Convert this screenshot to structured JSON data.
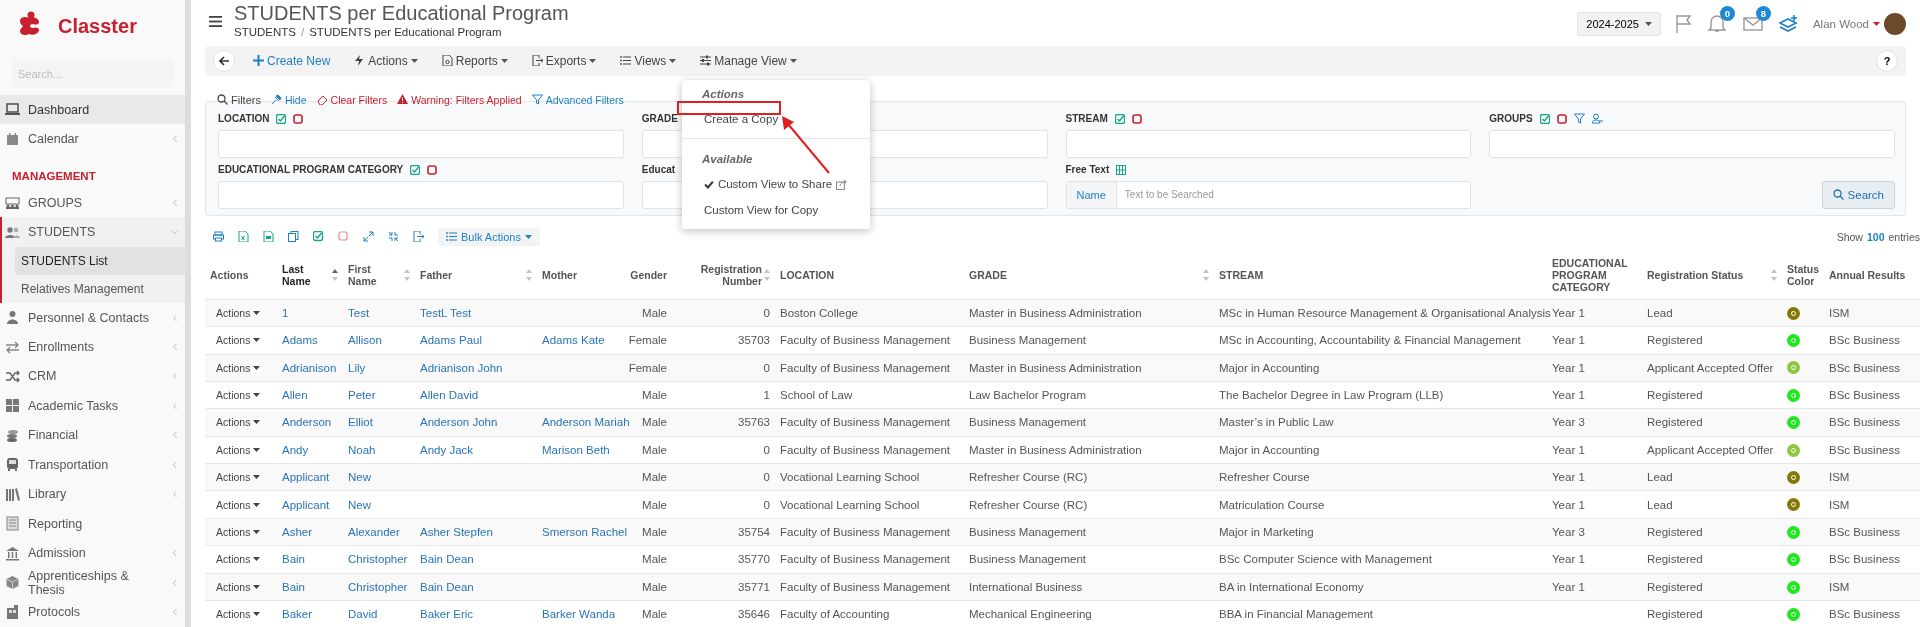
{
  "sidebar": {
    "brand": "Classter",
    "search_placeholder": "Search...",
    "items": [
      {
        "kind": "link",
        "label": "Dashboard",
        "highlighted": true,
        "submenu": false,
        "expanded": false
      },
      {
        "kind": "link",
        "label": "Calendar",
        "highlighted": false,
        "submenu": true,
        "expanded": false
      },
      {
        "kind": "heading",
        "label": "MANAGEMENT"
      },
      {
        "kind": "link",
        "label": "GROUPS",
        "highlighted": false,
        "submenu": true,
        "expanded": false
      },
      {
        "kind": "link",
        "label": "STUDENTS",
        "highlighted": false,
        "submenu": true,
        "expanded": true,
        "children": [
          {
            "label": "STUDENTS List",
            "selected": true
          },
          {
            "label": "Relatives Management",
            "selected": false
          }
        ]
      },
      {
        "kind": "link",
        "label": "Personnel & Contacts",
        "highlighted": false,
        "submenu": true,
        "expanded": false
      },
      {
        "kind": "link",
        "label": "Enrollments",
        "highlighted": false,
        "submenu": true,
        "expanded": false
      },
      {
        "kind": "link",
        "label": "CRM",
        "highlighted": false,
        "submenu": true,
        "expanded": false
      },
      {
        "kind": "link",
        "label": "Academic Tasks",
        "highlighted": false,
        "submenu": true,
        "expanded": false
      },
      {
        "kind": "link",
        "label": "Financial",
        "highlighted": false,
        "submenu": true,
        "expanded": false
      },
      {
        "kind": "link",
        "label": "Transportation",
        "highlighted": false,
        "submenu": true,
        "expanded": false
      },
      {
        "kind": "link",
        "label": "Library",
        "highlighted": false,
        "submenu": true,
        "expanded": false
      },
      {
        "kind": "link",
        "label": "Reporting",
        "highlighted": false,
        "submenu": false,
        "expanded": false
      },
      {
        "kind": "link",
        "label": "Admission",
        "highlighted": false,
        "submenu": true,
        "expanded": false
      },
      {
        "kind": "link",
        "label": "Apprenticeships & Thesis",
        "highlighted": false,
        "submenu": true,
        "expanded": false
      },
      {
        "kind": "link",
        "label": "Protocols",
        "highlighted": false,
        "submenu": true,
        "expanded": false
      }
    ]
  },
  "header": {
    "title": "STUDENTS per Educational Program",
    "breadcrumb": [
      "STUDENTS",
      "STUDENTS per Educational Program"
    ],
    "breadcrumb_separator": "/"
  },
  "topbar": {
    "year": "2024-2025",
    "notifications": "0",
    "messages": "8",
    "user": "Alan Wood"
  },
  "toolbar": {
    "buttons": [
      {
        "label": "Create New",
        "kind": "primary"
      },
      {
        "label": "Actions",
        "kind": "dropdown"
      },
      {
        "label": "Reports",
        "kind": "dropdown"
      },
      {
        "label": "Exports",
        "kind": "dropdown"
      },
      {
        "label": "Views",
        "kind": "dropdown"
      },
      {
        "label": "Manage View",
        "kind": "dropdown"
      }
    ],
    "help": "?"
  },
  "manage_view_menu": {
    "sections": [
      {
        "heading": "Actions",
        "items": [
          {
            "label": "Create a Copy",
            "checked": false,
            "shared": false
          }
        ]
      },
      {
        "heading": "Available",
        "items": [
          {
            "label": "Custom View to Share",
            "checked": true,
            "shared": true
          },
          {
            "label": "Custom View for Copy",
            "checked": false,
            "shared": false
          }
        ]
      }
    ]
  },
  "filters": {
    "title": "Filters",
    "links": [
      {
        "label": "Hide",
        "kind": "info"
      },
      {
        "label": "Clear Filters",
        "kind": "danger"
      },
      {
        "label": "Warning: Filters Applied",
        "kind": "warning"
      },
      {
        "label": "Advanced Filters",
        "kind": "info"
      }
    ],
    "fields": [
      {
        "label": "LOCATION",
        "kind": "select",
        "toggles": true
      },
      {
        "label": "GRADE",
        "kind": "select"
      },
      {
        "label": "STREAM",
        "kind": "select",
        "toggles": true
      },
      {
        "label": "GROUPS",
        "kind": "select_extra",
        "toggles": true
      },
      {
        "label": "EDUCATIONAL PROGRAM CATEGORY",
        "kind": "select",
        "toggles": true
      },
      {
        "label": "Educat",
        "kind": "select"
      },
      {
        "label": "Free Text",
        "kind": "text",
        "toggles": false,
        "addon": "Name",
        "placeholder": "Text to be Searched"
      }
    ],
    "search_button": "Search"
  },
  "table_tools": {
    "bulk_actions": "Bulk Actions",
    "show": "Show",
    "entries_count": "100",
    "entries": "entries"
  },
  "table": {
    "columns": [
      {
        "label": "Actions",
        "kind": "action",
        "sortable": false,
        "sort_active": false
      },
      {
        "label": "Last Name",
        "kind": "link",
        "sortable": true,
        "sort_active": true
      },
      {
        "label": "First Name",
        "kind": "link",
        "sortable": true,
        "sort_active": false
      },
      {
        "label": "Father",
        "kind": "link",
        "sortable": true,
        "sort_active": false
      },
      {
        "label": "Mother",
        "kind": "link",
        "sortable": false,
        "sort_active": false
      },
      {
        "label": "Gender",
        "kind": "right",
        "sortable": false,
        "sort_active": false
      },
      {
        "label": "Registration Number",
        "kind": "right",
        "sortable": true,
        "sort_active": false
      },
      {
        "label": "LOCATION",
        "kind": "text",
        "sortable": false,
        "sort_active": false
      },
      {
        "label": "GRADE",
        "kind": "text",
        "sortable": true,
        "sort_active": false
      },
      {
        "label": "STREAM",
        "kind": "text",
        "sortable": false,
        "sort_active": false
      },
      {
        "label": "EDUCATIONAL PROGRAM CATEGORY",
        "kind": "text",
        "sortable": false,
        "sort_active": false
      },
      {
        "label": "Registration Status",
        "kind": "text",
        "sortable": true,
        "sort_active": false
      },
      {
        "label": "Status Color",
        "kind": "color",
        "sortable": false,
        "sort_active": false
      },
      {
        "label": "Annual Results",
        "kind": "text"
      }
    ],
    "rows": [
      {
        "cells": [
          "Actions",
          "1",
          "Test",
          "TestL Test",
          "",
          "Male",
          "0",
          "Boston College",
          "Master in Business Administration",
          "MSc in Human Resource Management & Organisational Analysis",
          "Year 1",
          "Lead",
          "",
          "ISM"
        ],
        "color": "#827a05"
      },
      {
        "cells": [
          "Actions",
          "Adams",
          "Allison",
          "Adams Paul",
          "Adams Kate",
          "Female",
          "35703",
          "Faculty of Business Management",
          "Business Management",
          "MSc in Accounting, Accountability & Financial Management",
          "Year 1",
          "Registered",
          "",
          "BSc Business"
        ],
        "color": "#1ee81e"
      },
      {
        "cells": [
          "Actions",
          "Adrianison",
          "Lily",
          "Adrianison John",
          "",
          "Female",
          "0",
          "Faculty of Business Management",
          "Master in Business Administration",
          "Major in Accounting",
          "Year 1",
          "Applicant Accepted Offer",
          "",
          "BSc Business"
        ],
        "color": "#8dc63f"
      },
      {
        "cells": [
          "Actions",
          "Allen",
          "Peter",
          "Allen David",
          "",
          "Male",
          "1",
          "School of Law",
          "Law Bachelor Program",
          "The Bachelor Degree in Law Program (LLB)",
          "Year 1",
          "Registered",
          "",
          "BSc Business"
        ],
        "color": "#1ee81e"
      },
      {
        "cells": [
          "Actions",
          "Anderson",
          "Elliot",
          "Anderson John",
          "Anderson Mariah",
          "Male",
          "35763",
          "Faculty of Business Management",
          "Business Management",
          "Master’s in Public Law",
          "Year 3",
          "Registered",
          "",
          "BSc Business"
        ],
        "color": "#1ee81e"
      },
      {
        "cells": [
          "Actions",
          "Andy",
          "Noah",
          "Andy Jack",
          "Marison Beth",
          "Male",
          "0",
          "Faculty of Business Management",
          "Master in Business Administration",
          "Major in Accounting",
          "Year 1",
          "Applicant Accepted Offer",
          "",
          "BSc Business"
        ],
        "color": "#8dc63f"
      },
      {
        "cells": [
          "Actions",
          "Applicant",
          "New",
          "",
          "",
          "Male",
          "0",
          "Vocational Learning School",
          "Refresher Course (RC)",
          "Refresher Course",
          "Year 1",
          "Lead",
          "",
          "ISM"
        ],
        "color": "#827a05"
      },
      {
        "cells": [
          "Actions",
          "Applicant",
          "New",
          "",
          "",
          "Male",
          "0",
          "Vocational Learning School",
          "Refresher Course (RC)",
          "Matriculation Course",
          "Year 1",
          "Lead",
          "",
          "ISM"
        ],
        "color": "#827a05"
      },
      {
        "cells": [
          "Actions",
          "Asher",
          "Alexander",
          "Asher Stepfen",
          "Smerson Rachel",
          "Male",
          "35754",
          "Faculty of Business Management",
          "Business Management",
          "Major in Marketing",
          "Year 3",
          "Registered",
          "",
          "BSc Business"
        ],
        "color": "#1ee81e"
      },
      {
        "cells": [
          "Actions",
          "Bain",
          "Christopher",
          "Bain Dean",
          "",
          "Male",
          "35770",
          "Faculty of Business Management",
          "Business Management",
          "BSc Computer Science with Management",
          "Year 1",
          "Registered",
          "",
          "BSc Business"
        ],
        "color": "#1ee81e"
      },
      {
        "cells": [
          "Actions",
          "Bain",
          "Christopher",
          "Bain Dean",
          "",
          "Male",
          "35771",
          "Faculty of Business Management",
          "International Business",
          "BA in International Economy",
          "Year 1",
          "Registered",
          "",
          "ISM"
        ],
        "color": "#1ee81e"
      },
      {
        "cells": [
          "Actions",
          "Baker",
          "David",
          "Baker Eric",
          "Barker Wanda",
          "Male",
          "35646",
          "Faculty of Accounting",
          "Mechanical Engineering",
          "BBA in Financial Management",
          "",
          "Registered",
          "",
          "BSc Business"
        ],
        "color": "#1ee81e"
      }
    ]
  }
}
